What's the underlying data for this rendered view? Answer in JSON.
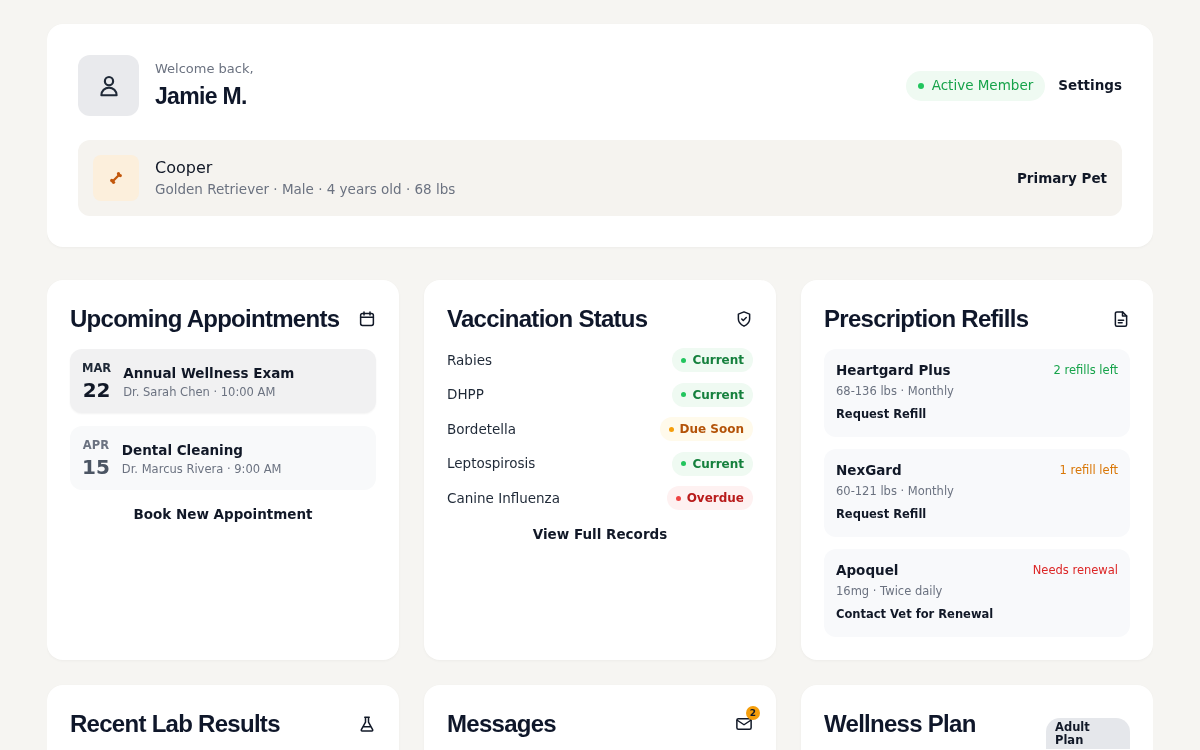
{
  "header": {
    "greeting": "Welcome back,",
    "user_name": "Jamie M.",
    "membership_status": "Active Member",
    "settings_link": "Settings"
  },
  "pet": {
    "name": "Cooper",
    "details": "Golden Retriever · Male · 4 years old · 68 lbs",
    "tag": "Primary Pet"
  },
  "appointments": {
    "title": "Upcoming Appointments",
    "items": [
      {
        "month": "MAR",
        "day": "22",
        "title": "Annual Wellness Exam",
        "details": "Dr. Sarah Chen · 10:00 AM",
        "selected": true
      },
      {
        "month": "APR",
        "day": "15",
        "title": "Dental Cleaning",
        "details": "Dr. Marcus Rivera · 9:00 AM",
        "selected": false
      }
    ],
    "action": "Book New Appointment"
  },
  "vaccinations": {
    "title": "Vaccination Status",
    "items": [
      {
        "name": "Rabies",
        "status": "Current",
        "kind": "current"
      },
      {
        "name": "DHPP",
        "status": "Current",
        "kind": "current"
      },
      {
        "name": "Bordetella",
        "status": "Due Soon",
        "kind": "due"
      },
      {
        "name": "Leptospirosis",
        "status": "Current",
        "kind": "current"
      },
      {
        "name": "Canine Influenza",
        "status": "Overdue",
        "kind": "overdue"
      }
    ],
    "action": "View Full Records"
  },
  "prescriptions": {
    "title": "Prescription Refills",
    "items": [
      {
        "name": "Heartgard Plus",
        "refills": "2 refills left",
        "kind": "ok",
        "details": "68-136 lbs · Monthly",
        "action": "Request Refill"
      },
      {
        "name": "NexGard",
        "refills": "1 refill left",
        "kind": "low",
        "details": "60-121 lbs · Monthly",
        "action": "Request Refill"
      },
      {
        "name": "Apoquel",
        "refills": "Needs renewal",
        "kind": "renewal",
        "details": "16mg · Twice daily",
        "action": "Contact Vet for Renewal"
      }
    ]
  },
  "lab_results": {
    "title": "Recent Lab Results"
  },
  "messages": {
    "title": "Messages",
    "unread_count": "2"
  },
  "wellness_plan": {
    "title": "Wellness Plan",
    "plan_badge": "Adult Plan"
  }
}
